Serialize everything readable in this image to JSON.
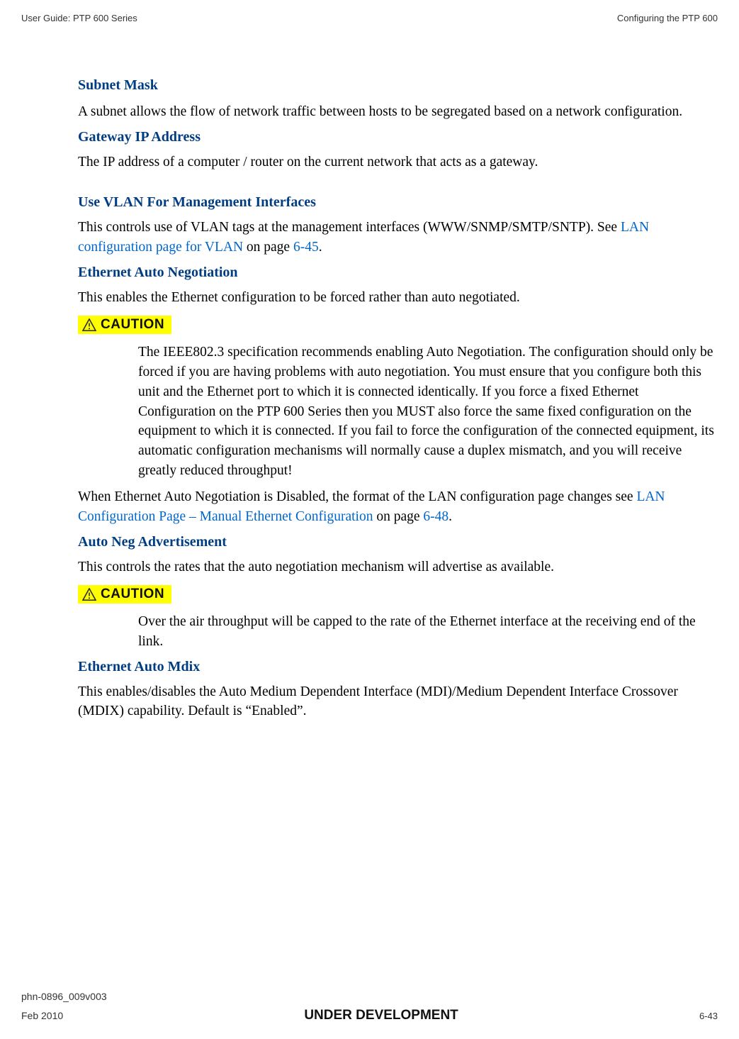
{
  "header": {
    "left": "User Guide: PTP 600 Series",
    "right": "Configuring the PTP 600"
  },
  "sections": {
    "subnet_mask": {
      "title": "Subnet Mask",
      "body": "A subnet allows the flow of network traffic between hosts to be segregated based on a network configuration."
    },
    "gateway": {
      "title": "Gateway IP Address",
      "body": "The IP address of a computer / router on the current network that acts as a gateway."
    },
    "vlan": {
      "title": "Use VLAN For Management Interfaces",
      "body_pre": "This controls use of VLAN tags at the management interfaces (WWW/SNMP/SMTP/SNTP). See ",
      "link": "LAN configuration page for VLAN",
      "body_mid": " on page ",
      "page_link": "6-45",
      "body_post": "."
    },
    "eth_auto_neg": {
      "title": "Ethernet Auto Negotiation",
      "body": "This enables the Ethernet configuration to be forced rather than auto negotiated.",
      "caution_label": "CAUTION",
      "caution_body": "The IEEE802.3 specification recommends enabling Auto Negotiation. The configuration should only be forced if you are having problems with auto negotiation. You must ensure that you configure both this unit and the Ethernet port to which it is connected identically. If you force a fixed Ethernet Configuration on the PTP 600 Series then you MUST also force the same fixed configuration on the equipment to which it is connected.  If you fail to force the configuration of the connected equipment, its automatic configuration mechanisms will normally cause a duplex mismatch, and you will receive greatly reduced throughput!",
      "after_pre": "When Ethernet Auto Negotiation is Disabled, the format of the LAN configuration page changes see ",
      "after_link": "LAN Configuration Page – Manual Ethernet Configuration",
      "after_mid": " on page ",
      "after_page_link": "6-48",
      "after_post": "."
    },
    "auto_neg_adv": {
      "title": "Auto Neg Advertisement",
      "body": "This controls the rates that the auto negotiation mechanism will advertise as available.",
      "caution_label": "CAUTION",
      "caution_body": "Over the air throughput will be capped to the rate of the Ethernet interface at the receiving end of the link."
    },
    "eth_auto_mdix": {
      "title": "Ethernet Auto Mdix",
      "body": "This enables/disables the Auto Medium Dependent Interface (MDI)/Medium Dependent Interface Crossover (MDIX) capability. Default is “Enabled”."
    }
  },
  "footer": {
    "doc_id": "phn-0896_009v003",
    "date": "Feb 2010",
    "status": "UNDER DEVELOPMENT",
    "page": "6-43"
  }
}
